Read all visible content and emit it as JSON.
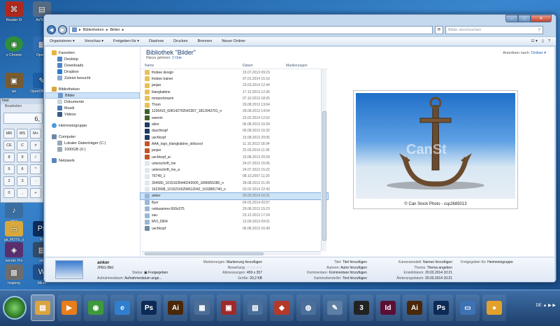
{
  "desktop": {
    "icons": [
      {
        "label": "Reader XI",
        "icon": "pdf-icon",
        "color": "#b0281d"
      },
      {
        "label": "Ar/Tage",
        "icon": "app-icon",
        "color": "#546b85"
      },
      {
        "label": "e Chrome",
        "icon": "chrome-icon",
        "color": "#2f8f3a"
      },
      {
        "label": "OpenO",
        "icon": "openoffice-icon",
        "color": "#2e6db4"
      },
      {
        "label": "ian",
        "icon": "app-icon",
        "color": "#7a5b2e"
      },
      {
        "label": "OpenOff Writer",
        "icon": "writer-icon",
        "color": "#1d5ea8"
      },
      {
        "label": "MP3",
        "icon": "music-file-icon",
        "color": "#3a6ea3"
      },
      {
        "label": "ga_MOTE_u",
        "icon": "folder-icon",
        "color": "#d8a83c"
      },
      {
        "label": "Ps",
        "icon": "photoshop-icon",
        "color": "#0b2c5e"
      },
      {
        "label": "nender Pro",
        "icon": "app-icon",
        "color": "#5b2f6e"
      },
      {
        "label": "alle",
        "icon": "app-icon",
        "color": "#324a66"
      },
      {
        "label": "hopping",
        "icon": "app-icon",
        "color": "#6d6d6d"
      },
      {
        "label": "Micrd",
        "icon": "app-icon",
        "color": "#1f4f8f"
      },
      {
        "label": "par",
        "icon": "app-icon",
        "color": "#777777"
      }
    ],
    "calculator": {
      "display": "6,",
      "title": "hner",
      "menu": "Bearbeiten",
      "keys": [
        "MR",
        "MS",
        "M+",
        "CE",
        "C",
        "±",
        "8",
        "9",
        "/",
        "5",
        "6",
        "*",
        "2",
        "3",
        "-",
        "0",
        ",",
        "+"
      ]
    }
  },
  "window": {
    "nav": {
      "back": "◀",
      "forward": "▶"
    },
    "address": {
      "segments": [
        "Bibliotheken",
        "Bilder"
      ]
    },
    "search": {
      "placeholder": "Bilder durchsuchen"
    },
    "toolbar": [
      "Organisieren ▾",
      "Vorschau ▾",
      "Freigeben für ▾",
      "Diashow",
      "Drucken",
      "Brennen",
      "Neuer Ordner"
    ],
    "navpane": {
      "favorites": {
        "label": "Favoriten",
        "items": [
          "Desktop",
          "Downloads",
          "Dropbox",
          "Zuletzt besucht"
        ]
      },
      "libraries": {
        "label": "Bibliotheken",
        "items": [
          "Bilder",
          "Dokumente",
          "Musik",
          "Videos"
        ]
      },
      "homegroup": "Heimnetzgruppe",
      "computer": {
        "label": "Computer",
        "items": [
          "Lokaler Datenträger (C:)",
          "1000GB (X:)"
        ]
      },
      "network": "Netzwerk"
    },
    "library": {
      "title": "Bibliothek \"Bilder\"",
      "subtitle_prefix": "Hierzu gehören:",
      "subtitle_link": "2 Orte",
      "arrange_label": "Anordnen nach:",
      "arrange_value": "Ordner ▾"
    },
    "columns": {
      "name": "Name",
      "date": "Datum",
      "tags": "Markierungen"
    },
    "files": [
      {
        "name": "frisbee design",
        "date": "15.07.2013 09:23",
        "kind": "folder"
      },
      {
        "name": "frisbee trainer",
        "date": "07.01.2014 15:16",
        "kind": "folder"
      },
      {
        "name": "janjan",
        "date": "23.03.2014 12:44",
        "kind": "folder"
      },
      {
        "name": "klangkabine",
        "date": "17.12.2013 12:36",
        "kind": "folder"
      },
      {
        "name": "mmpeckmann",
        "date": "07.10.2013 18:25",
        "kind": "folder"
      },
      {
        "name": "Thom",
        "date": "29.08.2013 13:04",
        "kind": "folder"
      },
      {
        "name": "1236410_608142792542307_1812943701_n",
        "date": "28.08.2013 14:04",
        "kind": "image"
      },
      {
        "name": "swenni",
        "date": "23.02.2014 12:52",
        "kind": "image"
      },
      {
        "name": "alien",
        "date": "06.08.2013 16:34",
        "kind": "image-dark"
      },
      {
        "name": "duschkopf",
        "date": "06.08.2013 16:32",
        "kind": "image-dark"
      },
      {
        "name": "uschkopf",
        "date": "15.08.2013 20:05",
        "kind": "image-dark"
      },
      {
        "name": "AAA_logo_klangkabine_oldscool",
        "date": "11.10.2013 18:34",
        "kind": "ai"
      },
      {
        "name": "janjan",
        "date": "22.03.2014 11:36",
        "kind": "ai"
      },
      {
        "name": "uschkopf_ai",
        "date": "15.08.2013 20:34",
        "kind": "ai"
      },
      {
        "name": "unterschrift_me",
        "date": "24.07.2013 15:05",
        "kind": "doc"
      },
      {
        "name": "unterschrift_me_a",
        "date": "24.07.2013 15:22",
        "kind": "doc"
      },
      {
        "name": "76749_1",
        "date": "08.10.2007 11:20",
        "kind": "doc"
      },
      {
        "name": "304580_10151635440242005_1896955280_n",
        "date": "28.08.2013 21:26",
        "kind": "doc"
      },
      {
        "name": "1623998_10152166258612042_1633881740_o",
        "date": "03.02.2014 22:43",
        "kind": "doc"
      },
      {
        "name": "anker",
        "date": "20.03.2014 10:21",
        "kind": "picture",
        "selected": true
      },
      {
        "name": "flyer",
        "date": "04.03.2014 00:57",
        "kind": "picture"
      },
      {
        "name": "nokiaammo-500x375",
        "date": "29.08.2013 15:23",
        "kind": "picture"
      },
      {
        "name": "sau",
        "date": "23.12.2013 17:24",
        "kind": "picture"
      },
      {
        "name": "MVI_0904",
        "date": "13.09.2013 09:01",
        "kind": "picture"
      },
      {
        "name": "uschkopf",
        "date": "06.08.2013 16:49",
        "kind": "png"
      }
    ],
    "preview": {
      "caption": "© Can Stock Photo - csp2685013",
      "watermark": "CanSt"
    },
    "details": {
      "name": "anker",
      "type": "JPEG-Bild",
      "status_label": "Status:",
      "status_value": "Freigegeben",
      "taken_label": "Aufnahmedatum:",
      "taken_value": "Aufnahmedatum ange...",
      "tags_label": "Markierungen:",
      "tags_value": "Markierung hinzufügen",
      "rating_label": "Bewertung:",
      "rating_value": "☆☆☆☆☆",
      "dims_label": "Abmessungen:",
      "dims_value": "450 x 357",
      "size_label": "Größe:",
      "size_value": "20,2 KB",
      "title_label": "Titel:",
      "title_value": "Titel hinzufügen",
      "authors_label": "Autoren:",
      "authors_value": "Autor hinzufügen",
      "comments_label": "Kommentare:",
      "comments_value": "Kommentare hinzufügen",
      "maker_label": "Kamerahersteller:",
      "maker_value": "Text hinzufügen",
      "model_label": "Kameramodell:",
      "model_value": "Namen hinzufügen",
      "subject_label": "Thema:",
      "subject_value": "Thema angeben",
      "created_label": "Erstelldatum:",
      "created_value": "20.03.2014 10:21",
      "modified_label": "Änderungsdatum:",
      "modified_value": "20.03.2014 10:21",
      "shared_label": "Freigegeben für:",
      "shared_value": "Heimnetzgruppe"
    }
  },
  "taskbar": {
    "apps": [
      {
        "name": "explorer",
        "glyph": "▤",
        "color": "#d9a441"
      },
      {
        "name": "media",
        "glyph": "▶",
        "color": "#e87d1b"
      },
      {
        "name": "chrome",
        "glyph": "◉",
        "color": "#3d9a3b"
      },
      {
        "name": "ie",
        "glyph": "e",
        "color": "#2f7fd1"
      },
      {
        "name": "ps",
        "glyph": "Ps",
        "color": "#0d2a55"
      },
      {
        "name": "ai",
        "glyph": "Ai",
        "color": "#4a2707"
      },
      {
        "name": "app1",
        "glyph": "▦",
        "color": "#4d6f96"
      },
      {
        "name": "app2",
        "glyph": "▣",
        "color": "#a02a2a"
      },
      {
        "name": "app3",
        "glyph": "▧",
        "color": "#4a6f9a"
      },
      {
        "name": "app4",
        "glyph": "◆",
        "color": "#b33a2a"
      },
      {
        "name": "app5",
        "glyph": "◍",
        "color": "#4a6f9a"
      },
      {
        "name": "app6",
        "glyph": "✎",
        "color": "#5e7fa5"
      },
      {
        "name": "app7",
        "glyph": "3",
        "color": "#222222"
      },
      {
        "name": "id",
        "glyph": "Id",
        "color": "#5b0f34"
      },
      {
        "name": "ai2",
        "glyph": "Ai",
        "color": "#4a2707"
      },
      {
        "name": "ps2",
        "glyph": "Ps",
        "color": "#0d2a55"
      },
      {
        "name": "app8",
        "glyph": "▭",
        "color": "#3d72b5"
      },
      {
        "name": "app9",
        "glyph": "●",
        "color": "#e1a12c"
      }
    ],
    "tray": "DE ▲ ▶ ▶"
  }
}
